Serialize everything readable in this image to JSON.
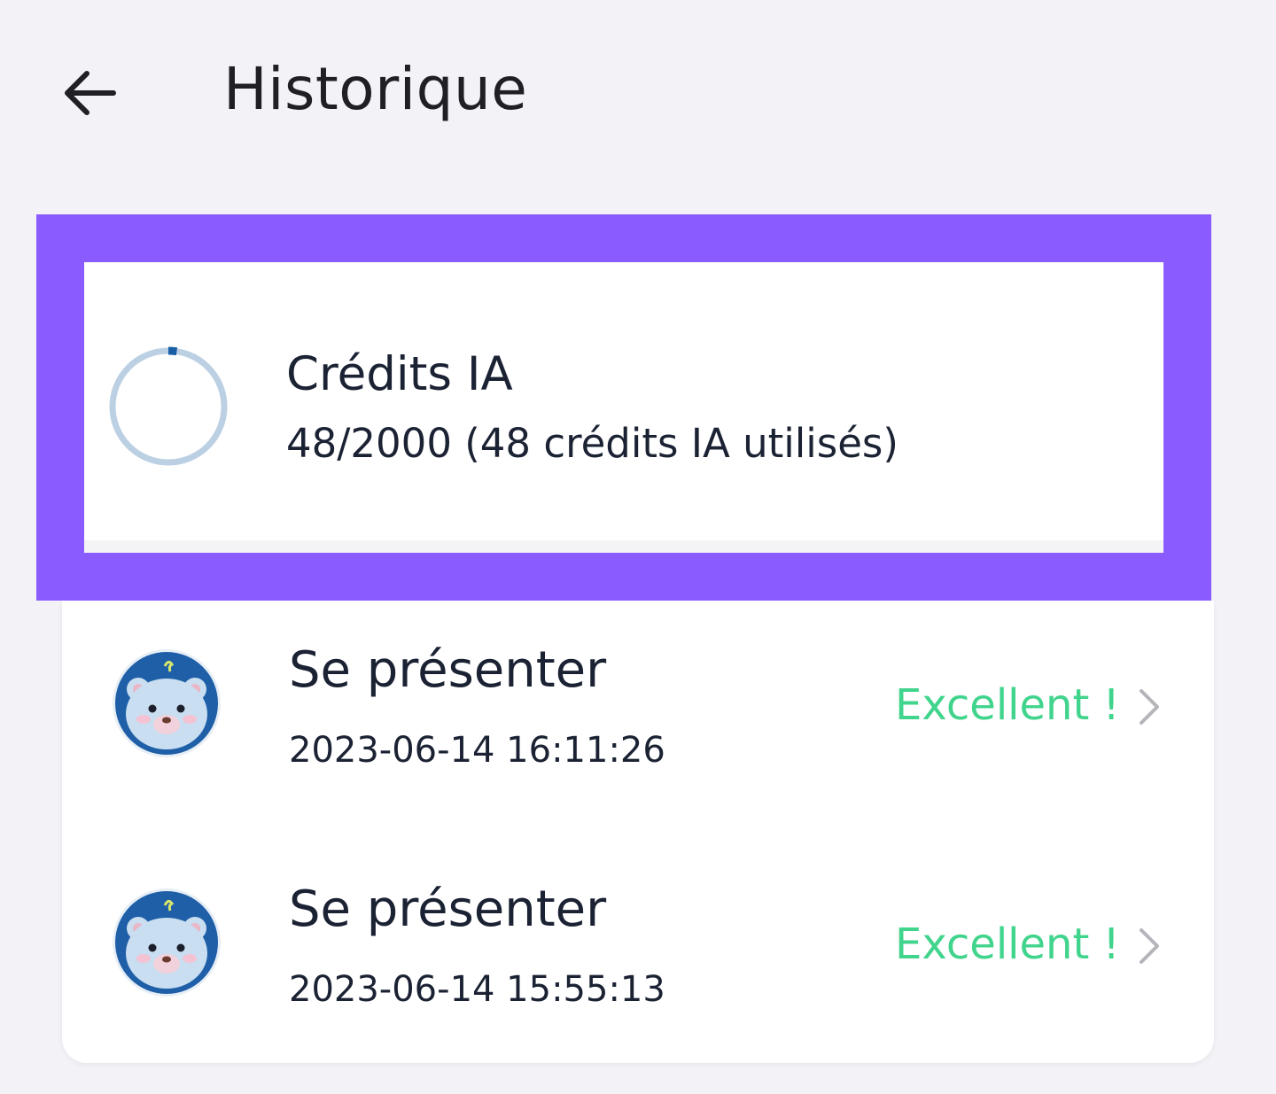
{
  "header": {
    "title": "Historique",
    "back_icon": "arrow-left-icon"
  },
  "credits": {
    "title": "Crédits IA",
    "usage": "48/2000 (48 crédits IA utilisés)",
    "used": 48,
    "total": 2000,
    "ring_track_color": "#bcd0e4",
    "ring_progress_color": "#1a5fa5",
    "highlight_color": "#8a5cff"
  },
  "history": {
    "items": [
      {
        "title": "Se présenter",
        "timestamp": "2023-06-14 16:11:26",
        "score": "Excellent !",
        "avatar_icon": "polar-bear-avatar-icon"
      },
      {
        "title": "Se présenter",
        "timestamp": "2023-06-14 15:55:13",
        "score": "Excellent !",
        "avatar_icon": "polar-bear-avatar-icon"
      }
    ],
    "score_color": "#41d48c"
  }
}
